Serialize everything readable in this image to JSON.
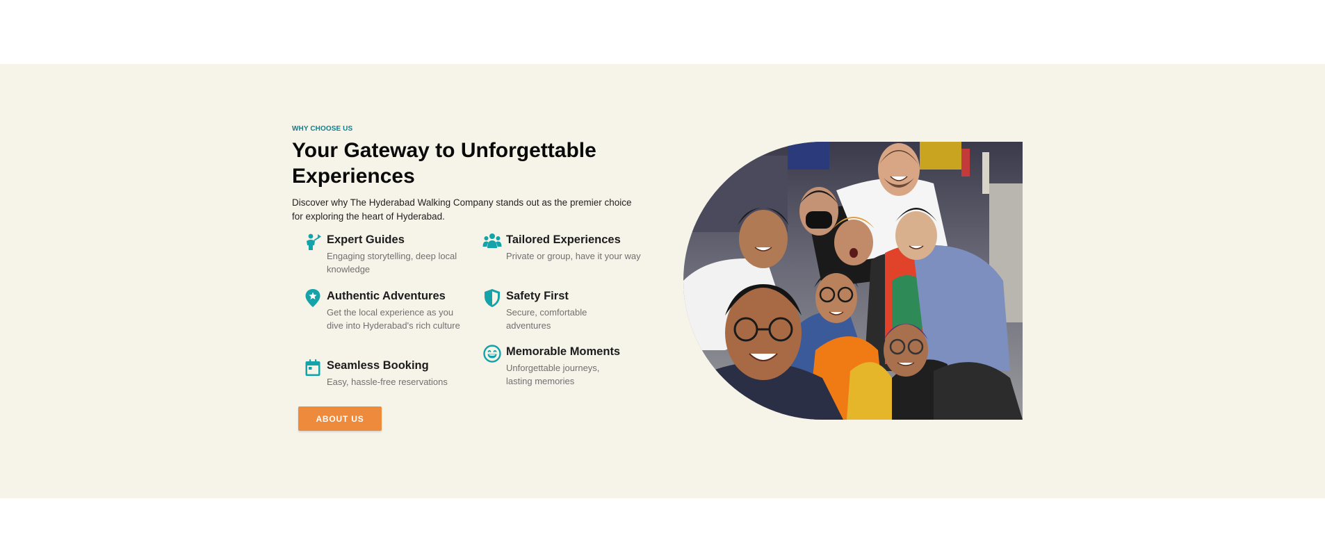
{
  "section": {
    "eyebrow": "WHY CHOOSE US",
    "title": "Your Gateway to Unforgettable Experiences",
    "subtitle": "Discover why The Hyderabad Walking Company stands out as the premier choice for exploring the heart of Hyderabad."
  },
  "features": {
    "expert_guides": {
      "icon": "guide-icon",
      "title": "Expert Guides",
      "description": "Engaging storytelling, deep local knowledge"
    },
    "tailored_experiences": {
      "icon": "group-icon",
      "title": "Tailored Experiences",
      "description": "Private or group, have it your way"
    },
    "authentic_adventures": {
      "icon": "location-star-icon",
      "title": "Authentic Adventures",
      "description": "Get the local experience as you dive into Hyderabad's rich culture"
    },
    "safety_first": {
      "icon": "shield-icon",
      "title": "Safety First",
      "description": "Secure, comfortable adventures"
    },
    "seamless_booking": {
      "icon": "calendar-icon",
      "title": "Seamless Booking",
      "description": "Easy, hassle-free reservations"
    },
    "memorable_moments": {
      "icon": "smile-icon",
      "title": "Memorable Moments",
      "description": "Unforgettable journeys, lasting memories"
    }
  },
  "cta": {
    "label": "ABOUT US"
  },
  "colors": {
    "accent_teal": "#14a3a8",
    "eyebrow_teal": "#0f7f8c",
    "button_orange": "#ed8a3c",
    "band_background": "#f6f3e9"
  },
  "image": {
    "description_icon": "group-selfie-photo"
  }
}
